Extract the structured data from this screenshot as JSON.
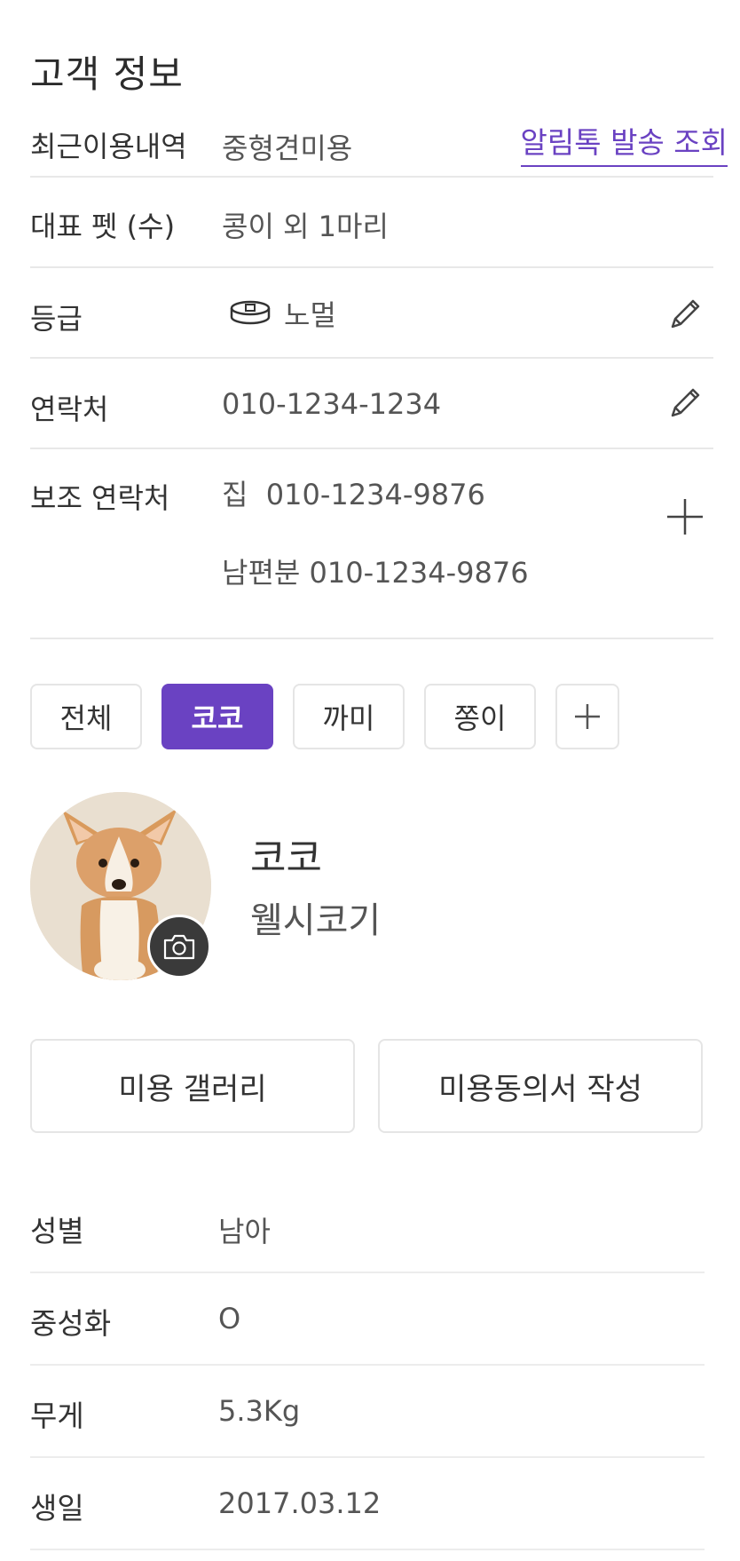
{
  "header": {
    "title": "고객 정보"
  },
  "customer": {
    "recent": {
      "label": "최근이용내역",
      "value": "중형견미용",
      "link": "알림톡 발송 조회"
    },
    "main_pet": {
      "label": "대표 펫 (수)",
      "value": "콩이 외 1마리"
    },
    "grade": {
      "label": "등급",
      "value": "노멀",
      "icon": "collar-icon"
    },
    "contact": {
      "label": "연락처",
      "value": "010-1234-1234"
    },
    "sub_contact": {
      "label": "보조 연락처",
      "items": [
        {
          "tag": "집",
          "number": "010-1234-9876"
        },
        {
          "tag": "남편분",
          "number": "010-1234-9876"
        }
      ]
    }
  },
  "pet_tabs": {
    "items": [
      "전체",
      "코코",
      "까미",
      "쫑이"
    ],
    "selected": "코코",
    "add_icon": "plus-icon"
  },
  "pet": {
    "name": "코코",
    "breed": "웰시코기",
    "camera_icon": "camera-icon"
  },
  "actions": {
    "gallery": "미용 갤러리",
    "consent": "미용동의서 작성"
  },
  "pet_info": [
    {
      "label": "성별",
      "value": "남아"
    },
    {
      "label": "중성화",
      "value": "O"
    },
    {
      "label": "무게",
      "value": "5.3Kg"
    },
    {
      "label": "생일",
      "value": "2017.03.12"
    }
  ],
  "colors": {
    "accent": "#6a42c2",
    "divider": "#e8e8e8",
    "text": "#333333"
  }
}
